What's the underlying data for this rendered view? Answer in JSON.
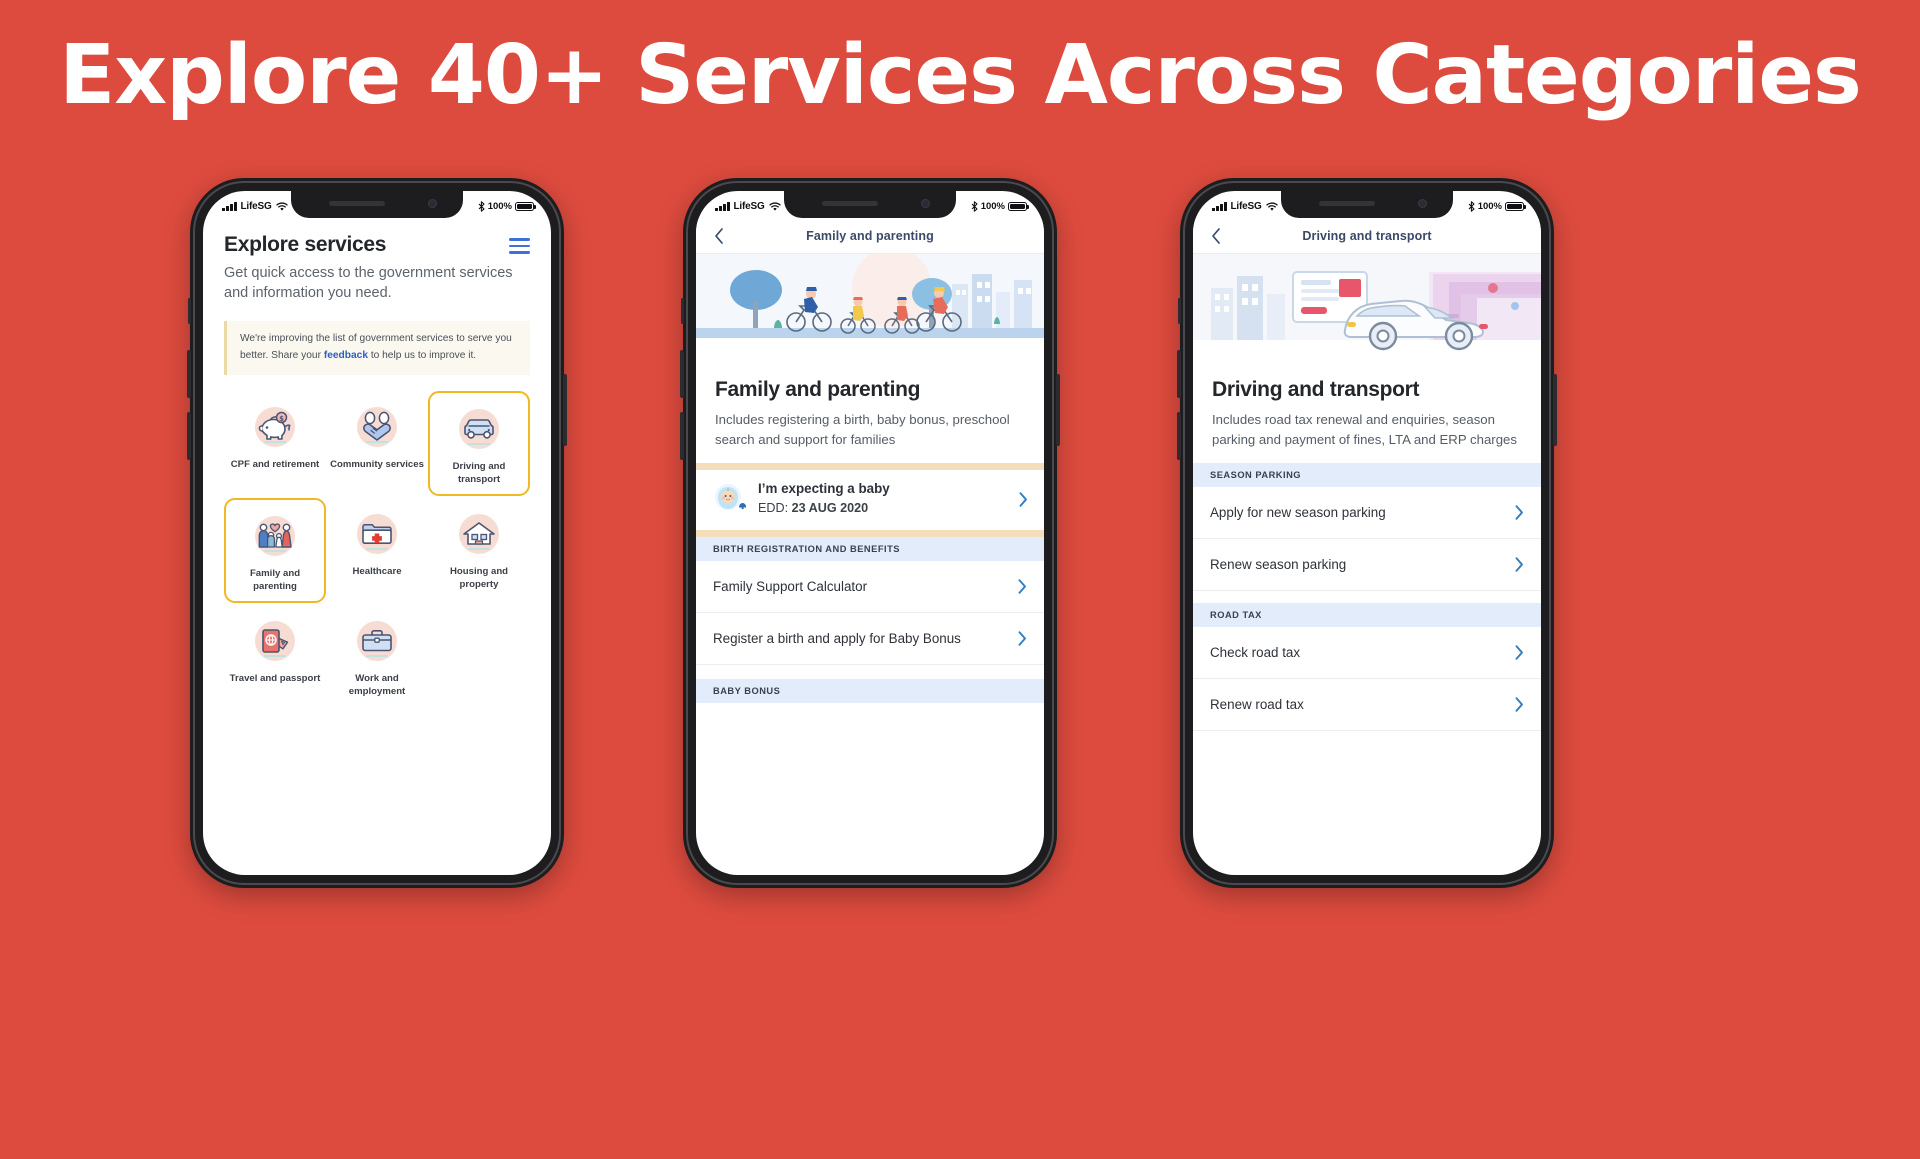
{
  "page": {
    "headline": "Explore 40+ Services Across Categories",
    "background_color": "#DD4B3E",
    "accent_highlight_color": "#F2B824",
    "link_color": "#2A5FC4"
  },
  "status_bar": {
    "carrier": "LifeSG",
    "battery_percent": "100%",
    "signal_icon": "signal-bars-icon",
    "wifi_icon": "wifi-icon",
    "bluetooth_icon": "bluetooth-icon",
    "battery_icon": "battery-full-icon"
  },
  "phone1": {
    "title": "Explore services",
    "subtitle": "Get quick access to the government services and information you need.",
    "menu_icon": "hamburger-menu-icon",
    "notice": {
      "text_before": "We're improving the list of government services to serve you better. Share your ",
      "link": "feedback",
      "text_after": " to help us to improve it."
    },
    "categories": [
      {
        "label": "CPF and retirement",
        "icon": "piggy-bank-icon",
        "highlighted": false
      },
      {
        "label": "Community services",
        "icon": "handshake-icon",
        "highlighted": false
      },
      {
        "label": "Driving and transport",
        "icon": "car-icon",
        "highlighted": true
      },
      {
        "label": "Family and parenting",
        "icon": "family-icon",
        "highlighted": true
      },
      {
        "label": "Healthcare",
        "icon": "medical-folder-icon",
        "highlighted": false
      },
      {
        "label": "Housing and property",
        "icon": "house-icon",
        "highlighted": false
      },
      {
        "label": "Travel and passport",
        "icon": "passport-icon",
        "highlighted": false
      },
      {
        "label": "Work and employment",
        "icon": "briefcase-icon",
        "highlighted": false
      }
    ]
  },
  "phone2": {
    "appbar_title": "Family and parenting",
    "back_icon": "chevron-left-icon",
    "hero_icon": "family-cycling-illustration",
    "title": "Family and parenting",
    "description": "Includes registering a birth, baby bonus, preschool search and support for families",
    "expecting_card": {
      "icon": "baby-icon",
      "badge_icon": "bell-icon",
      "title": "I’m expecting a baby",
      "edd_label": "EDD: ",
      "edd_value": "23 AUG 2020",
      "chevron_icon": "chevron-right-icon"
    },
    "sections": [
      {
        "heading": "BIRTH REGISTRATION AND BENEFITS",
        "items": [
          {
            "label": "Family Support Calculator",
            "chevron_icon": "chevron-right-icon"
          },
          {
            "label": "Register a birth and apply for Baby Bonus",
            "chevron_icon": "chevron-right-icon"
          }
        ]
      },
      {
        "heading": "BABY BONUS",
        "items": []
      }
    ]
  },
  "phone3": {
    "appbar_title": "Driving and transport",
    "back_icon": "chevron-left-icon",
    "hero_icon": "car-city-illustration",
    "title": "Driving and transport",
    "description": "Includes road tax renewal and enquiries, season parking and payment of fines, LTA and ERP charges",
    "sections": [
      {
        "heading": "SEASON PARKING",
        "items": [
          {
            "label": "Apply for new season parking",
            "chevron_icon": "chevron-right-icon"
          },
          {
            "label": "Renew season parking",
            "chevron_icon": "chevron-right-icon"
          }
        ]
      },
      {
        "heading": "ROAD TAX",
        "items": [
          {
            "label": "Check road tax",
            "chevron_icon": "chevron-right-icon"
          },
          {
            "label": "Renew road tax",
            "chevron_icon": "chevron-right-icon"
          }
        ]
      }
    ]
  }
}
